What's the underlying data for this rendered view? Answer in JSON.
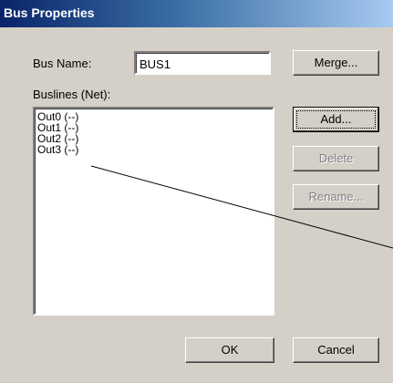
{
  "window": {
    "title": "Bus Properties"
  },
  "bus_name": {
    "label": "Bus Name:",
    "value": "BUS1"
  },
  "buslines": {
    "label": "Buslines (Net):",
    "items": [
      "Out0 (--)",
      "Out1 (--)",
      "Out2 (--)",
      "Out3 (--)"
    ]
  },
  "buttons": {
    "merge": "Merge...",
    "add": "Add...",
    "delete": "Delete",
    "rename": "Rename...",
    "ok": "OK",
    "cancel": "Cancel"
  },
  "colors": {
    "title_bar_start": "#0a246a",
    "dialog_face": "#d4d0c8"
  }
}
